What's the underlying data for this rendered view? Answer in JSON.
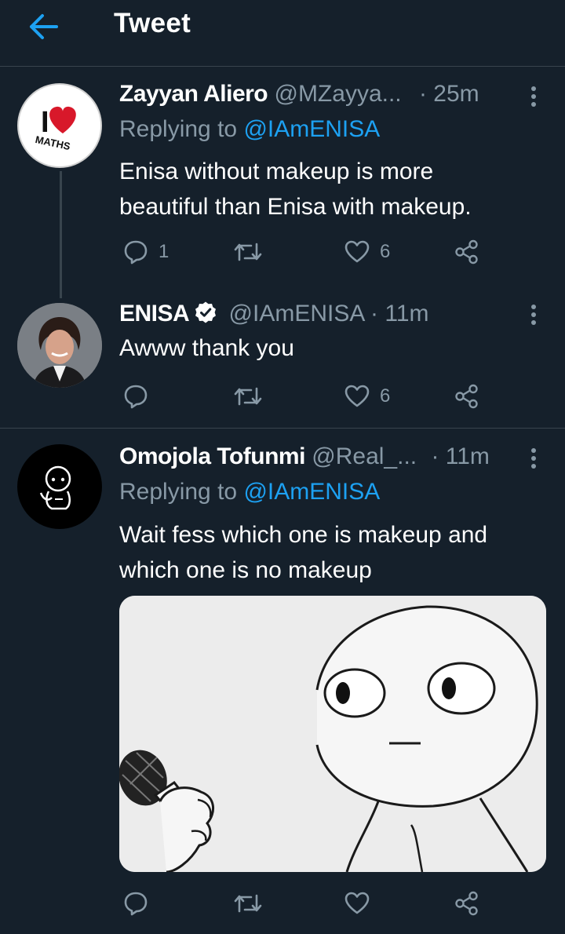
{
  "header": {
    "title": "Tweet",
    "back_icon": "arrow-left-icon"
  },
  "colors": {
    "background": "#15202b",
    "accent": "#1da1f2",
    "muted": "#8899a6",
    "divider": "#38444d"
  },
  "tweets": [
    {
      "display_name": "Zayyan Aliero",
      "handle": "@MZayya...",
      "time": "· 25m",
      "replying_prefix": "Replying to",
      "replying_to": "@IAmENISA",
      "text": "Enisa without makeup is more beautiful than Enisa with makeup.",
      "avatar_text": {
        "big": "I",
        "small": "MATHS"
      },
      "replies": "1",
      "likes": "6"
    },
    {
      "display_name": "ENISA",
      "handle": "@IAmENISA",
      "time": "· 11m",
      "text": "Awww thank you",
      "verified": true,
      "replies": "",
      "likes": "6"
    },
    {
      "display_name": "Omojola Tofunmi",
      "handle": "@Real_...",
      "time": "· 11m",
      "replying_prefix": "Replying to",
      "replying_to": "@IAmENISA",
      "text_lines": [
        "Wait fess which one is makeup and",
        "which one is no makeup"
      ],
      "replies": "",
      "likes": ""
    }
  ],
  "icons": [
    "reply-icon",
    "retweet-icon",
    "like-icon",
    "share-icon",
    "more-icon",
    "verified-badge-icon"
  ]
}
